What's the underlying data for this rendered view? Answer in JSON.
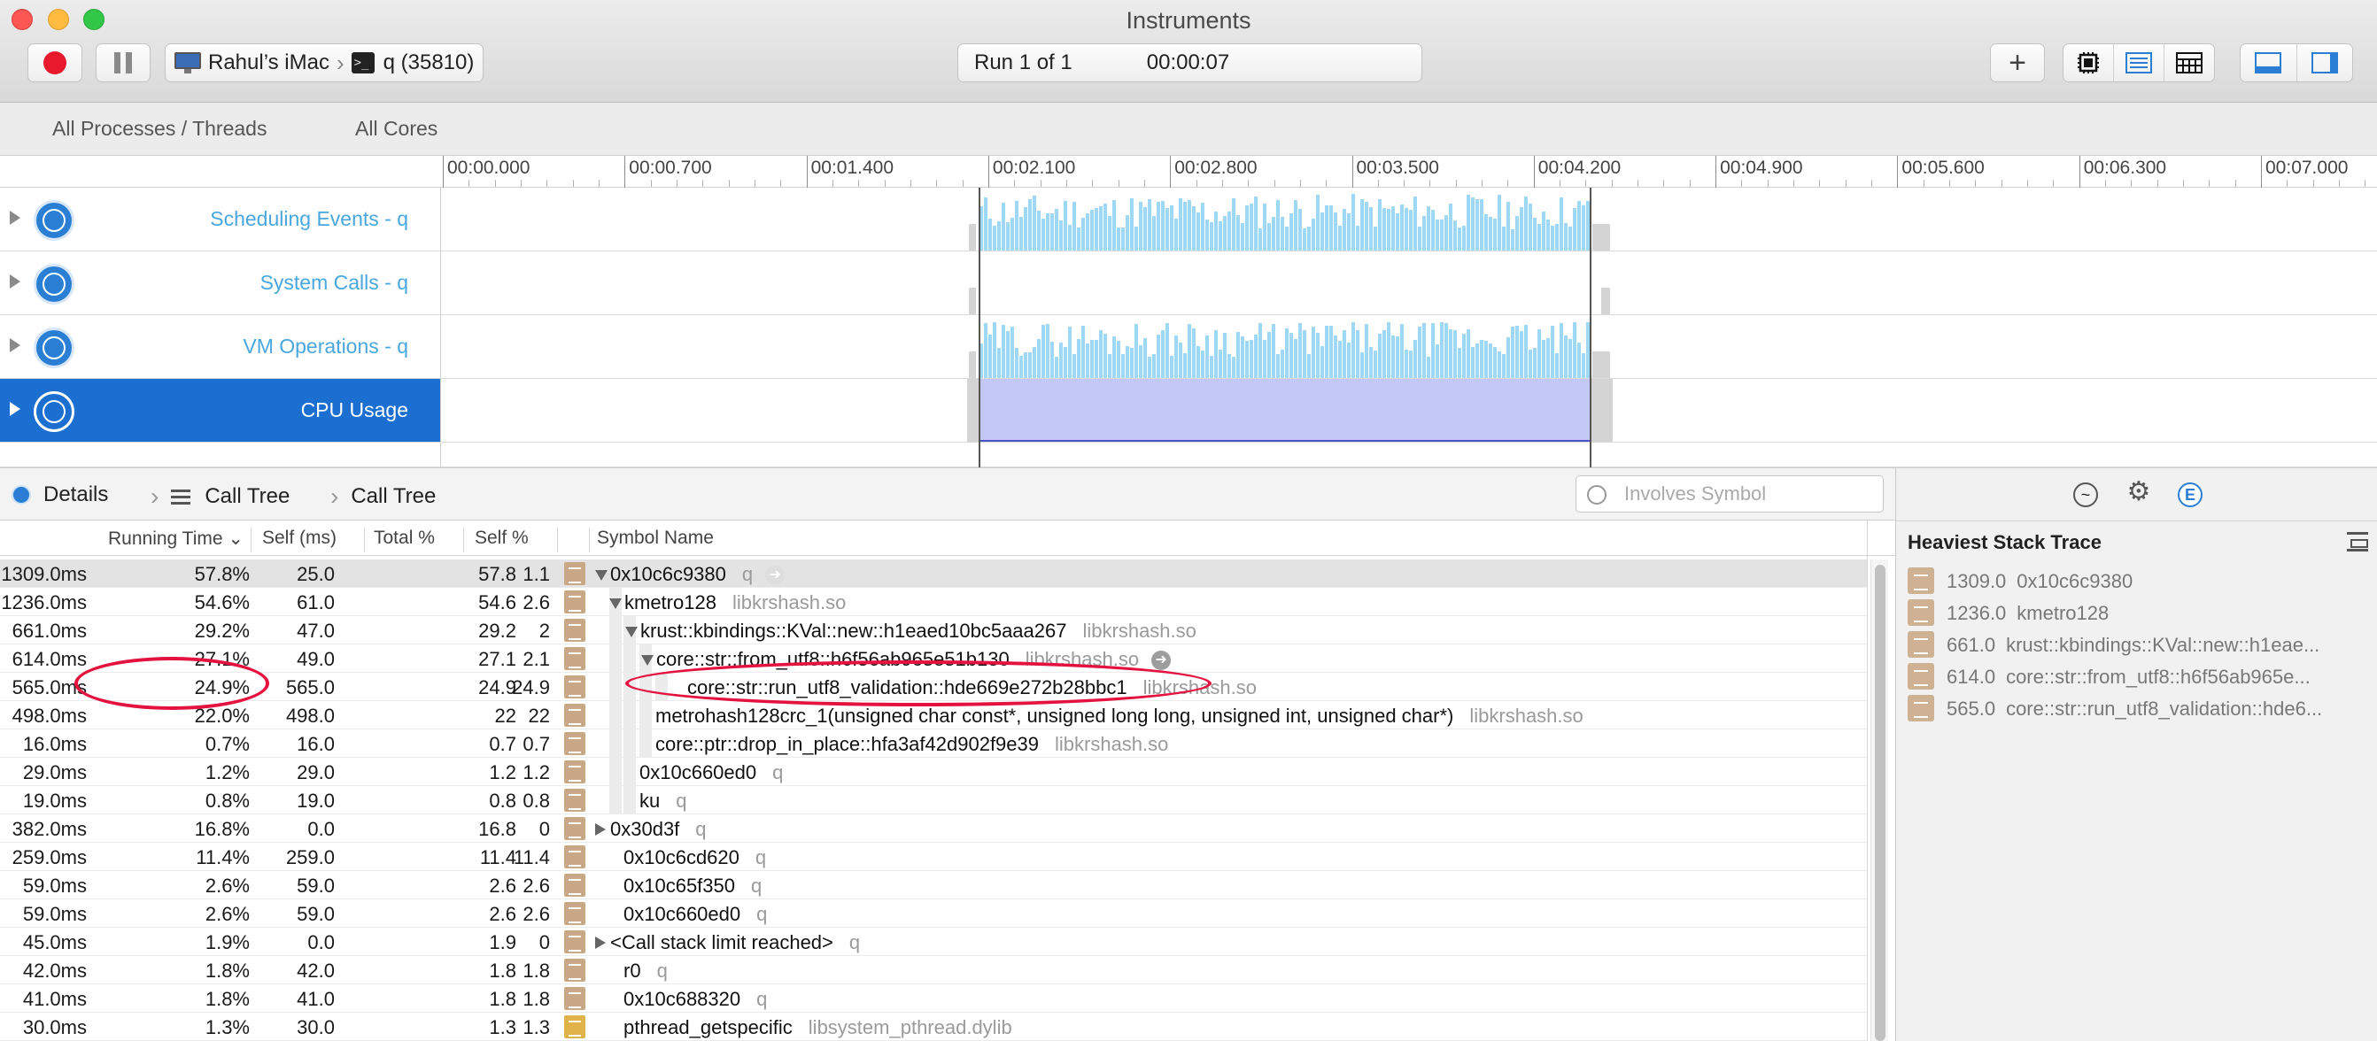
{
  "window": {
    "title": "Instruments"
  },
  "toolbar": {
    "target_device": "Rahul’s iMac",
    "target_process": "q (35810)",
    "run_label": "Run 1 of 1",
    "run_time": "00:00:07"
  },
  "scope": {
    "processes": "All Processes / Threads",
    "cores": "All Cores"
  },
  "ruler": [
    "00:00.000",
    "00:00.700",
    "00:01.400",
    "00:02.100",
    "00:02.800",
    "00:03.500",
    "00:04.200",
    "00:04.900",
    "00:05.600",
    "00:06.300",
    "00:07.000"
  ],
  "tracks": [
    {
      "name": "Scheduling Events - q",
      "icon": "scheduling-icon"
    },
    {
      "name": "System Calls - q",
      "icon": "system-calls-icon"
    },
    {
      "name": "VM Operations - q",
      "icon": "vm-operations-icon"
    },
    {
      "name": "CPU Usage",
      "icon": "cpu-usage-icon"
    }
  ],
  "detail_nav": {
    "details": "Details",
    "calltree1": "Call Tree",
    "calltree2": "Call Tree",
    "filter_placeholder": "Involves Symbol"
  },
  "table": {
    "headers": {
      "running_time": "Running Time",
      "self_ms": "Self (ms)",
      "total_pct": "Total %",
      "self_pct": "Self %",
      "symbol": "Symbol Name"
    },
    "rows": [
      {
        "ms": "1309.0ms",
        "pct": "57.8%",
        "self": "25.0",
        "total": "57.8",
        "selfpct": "1.1",
        "symbol": "0x10c6c9380",
        "lib": "q"
      },
      {
        "ms": "1236.0ms",
        "pct": "54.6%",
        "self": "61.0",
        "total": "54.6",
        "selfpct": "2.6",
        "symbol": "kmetro128",
        "lib": "libkrshash.so"
      },
      {
        "ms": "661.0ms",
        "pct": "29.2%",
        "self": "47.0",
        "total": "29.2",
        "selfpct": "2",
        "symbol": "krust::kbindings::KVal::new::h1eaed10bc5aaa267",
        "lib": "libkrshash.so"
      },
      {
        "ms": "614.0ms",
        "pct": "27.1%",
        "self": "49.0",
        "total": "27.1",
        "selfpct": "2.1",
        "symbol": "core::str::from_utf8::h6f56ab965e51b130",
        "lib": "libkrshash.so"
      },
      {
        "ms": "565.0ms",
        "pct": "24.9%",
        "self": "565.0",
        "total": "24.9",
        "selfpct": "24.9",
        "symbol": "core::str::run_utf8_validation::hde669e272b28bbc1",
        "lib": "libkrshash.so"
      },
      {
        "ms": "498.0ms",
        "pct": "22.0%",
        "self": "498.0",
        "total": "22",
        "selfpct": "22",
        "symbol": "metrohash128crc_1(unsigned char const*, unsigned long long, unsigned int, unsigned char*)",
        "lib": "libkrshash.so"
      },
      {
        "ms": "16.0ms",
        "pct": "0.7%",
        "self": "16.0",
        "total": "0.7",
        "selfpct": "0.7",
        "symbol": "core::ptr::drop_in_place::hfa3af42d902f9e39",
        "lib": "libkrshash.so"
      },
      {
        "ms": "29.0ms",
        "pct": "1.2%",
        "self": "29.0",
        "total": "1.2",
        "selfpct": "1.2",
        "symbol": "0x10c660ed0",
        "lib": "q"
      },
      {
        "ms": "19.0ms",
        "pct": "0.8%",
        "self": "19.0",
        "total": "0.8",
        "selfpct": "0.8",
        "symbol": "ku",
        "lib": "q"
      },
      {
        "ms": "382.0ms",
        "pct": "16.8%",
        "self": "0.0",
        "total": "16.8",
        "selfpct": "0",
        "symbol": "0x30d3f",
        "lib": "q"
      },
      {
        "ms": "259.0ms",
        "pct": "11.4%",
        "self": "259.0",
        "total": "11.4",
        "selfpct": "11.4",
        "symbol": "0x10c6cd620",
        "lib": "q"
      },
      {
        "ms": "59.0ms",
        "pct": "2.6%",
        "self": "59.0",
        "total": "2.6",
        "selfpct": "2.6",
        "symbol": "0x10c65f350",
        "lib": "q"
      },
      {
        "ms": "59.0ms",
        "pct": "2.6%",
        "self": "59.0",
        "total": "2.6",
        "selfpct": "2.6",
        "symbol": "0x10c660ed0",
        "lib": "q"
      },
      {
        "ms": "45.0ms",
        "pct": "1.9%",
        "self": "0.0",
        "total": "1.9",
        "selfpct": "0",
        "symbol": "<Call stack limit reached>",
        "lib": "q"
      },
      {
        "ms": "42.0ms",
        "pct": "1.8%",
        "self": "42.0",
        "total": "1.8",
        "selfpct": "1.8",
        "symbol": "r0",
        "lib": "q"
      },
      {
        "ms": "41.0ms",
        "pct": "1.8%",
        "self": "41.0",
        "total": "1.8",
        "selfpct": "1.8",
        "symbol": "0x10c688320",
        "lib": "q"
      },
      {
        "ms": "30.0ms",
        "pct": "1.3%",
        "self": "30.0",
        "total": "1.3",
        "selfpct": "1.3",
        "symbol": "pthread_getspecific",
        "lib": "libsystem_pthread.dylib"
      }
    ]
  },
  "inspector": {
    "title": "Heaviest Stack Trace",
    "rows": [
      {
        "weight": "1309.0",
        "symbol": "0x10c6c9380"
      },
      {
        "weight": "1236.0",
        "symbol": "kmetro128"
      },
      {
        "weight": "661.0",
        "symbol": "krust::kbindings::KVal::new::h1eae..."
      },
      {
        "weight": "614.0",
        "symbol": "core::str::from_utf8::h6f56ab965e..."
      },
      {
        "weight": "565.0",
        "symbol": "core::str::run_utf8_validation::hde6..."
      }
    ]
  },
  "colors": {
    "accent": "#1a6fd0",
    "record": "#e8192c",
    "annotation": "#e4123e",
    "cpu_fill": "#c3c8f7",
    "activity_bars": "#9fd8f5"
  }
}
